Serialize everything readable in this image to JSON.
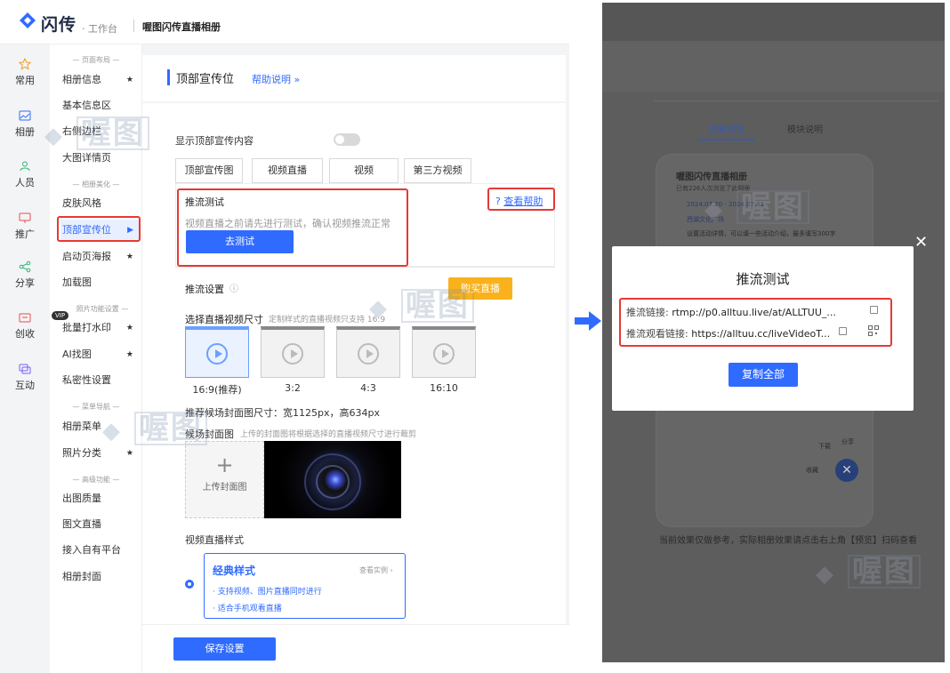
{
  "brand": {
    "name": "闪传",
    "sub": "· 工作台",
    "album": "喔图闪传直播相册"
  },
  "iconbar": [
    "常用",
    "相册",
    "人员",
    "推广",
    "分享",
    "创收",
    "互动"
  ],
  "menu": {
    "sec_layout": "— 页面布局 —",
    "layout_items": [
      "相册信息",
      "基本信息区",
      "右侧边栏",
      "大图详情页"
    ],
    "sec_beauty": "— 相册美化 —",
    "beauty_items": [
      "皮肤风格",
      "顶部宣传位",
      "启动页海报",
      "加载图"
    ],
    "sec_photo": "照片功能设置 —",
    "vip": "VIP",
    "photo_items": [
      "批量打水印",
      "AI找图",
      "私密性设置"
    ],
    "sec_nav": "— 菜单导航 —",
    "nav_items": [
      "相册菜单",
      "照片分类"
    ],
    "sec_adv": "— 高级功能 —",
    "adv_items": [
      "出图质量",
      "图文直播",
      "接入自有平台",
      "相册封面"
    ],
    "star": "★",
    "arrow": "▶"
  },
  "page": {
    "title": "顶部宣传位",
    "help": "帮助说明 »",
    "show_label": "显示顶部宣传内容",
    "tabs": [
      "顶部宣传图",
      "视频直播",
      "视频",
      "第三方视频"
    ],
    "push_test_title": "推流测试",
    "view_help": "查看帮助",
    "push_test_desc": "视频直播之前请先进行测试，确认视频推流正常",
    "test_btn": "去测试",
    "push_settings": "推流设置",
    "buy_btn": "购买直播",
    "size_label": "选择直播视频尺寸",
    "size_hint": "定制样式的直播视频只支持 16:9",
    "sizes": [
      "16:9(推荐)",
      "3:2",
      "4:3",
      "16:10"
    ],
    "cover_size": "推荐候场封面图尺寸：宽1125px，高634px",
    "cover_label": "候场封面图",
    "cover_hint": "上传的封面图将根据选择的直播视频尺寸进行裁剪",
    "upload": "上传封面图",
    "style_label": "视频直播样式",
    "style_name": "经典样式",
    "style_link": "查看实例 ›",
    "style_f1": "· 支持视频、图片直播同时进行",
    "style_f2": "· 适合手机观看直播",
    "save_btn": "保存设置"
  },
  "right": {
    "tab_preview": "效果预览",
    "tab_module": "模块说明",
    "phone_title": "喔图闪传直播相册",
    "phone_sub": "已有226人次浏览了此相册",
    "phone_date": "2024.07.20 - 2024.07.31",
    "phone_loc": "西湖文化广场",
    "phone_tip": "设置活动详情，可以填一些活动介绍，最多填写300字",
    "phone_dl": "下载",
    "phone_share": "分享",
    "phone_fav": "收藏",
    "footer": "当前效果仅做参考，实际相册效果请点击右上角【预览】扫码查看"
  },
  "modal": {
    "title": "推流测试",
    "push_url_label": "推流链接:",
    "push_url": "rtmp://p0.alltuu.live/at/ALLTUU_...",
    "watch_url_label": "推流观看链接:",
    "watch_url": "https://alltuu.cc/liveVideoT...",
    "copy_all": "复制全部",
    "close": "✕"
  },
  "watermark": "喔图",
  "colors": {
    "accent": "#2f6bff",
    "highlight": "#e53935",
    "buy": "#f9b21c"
  }
}
